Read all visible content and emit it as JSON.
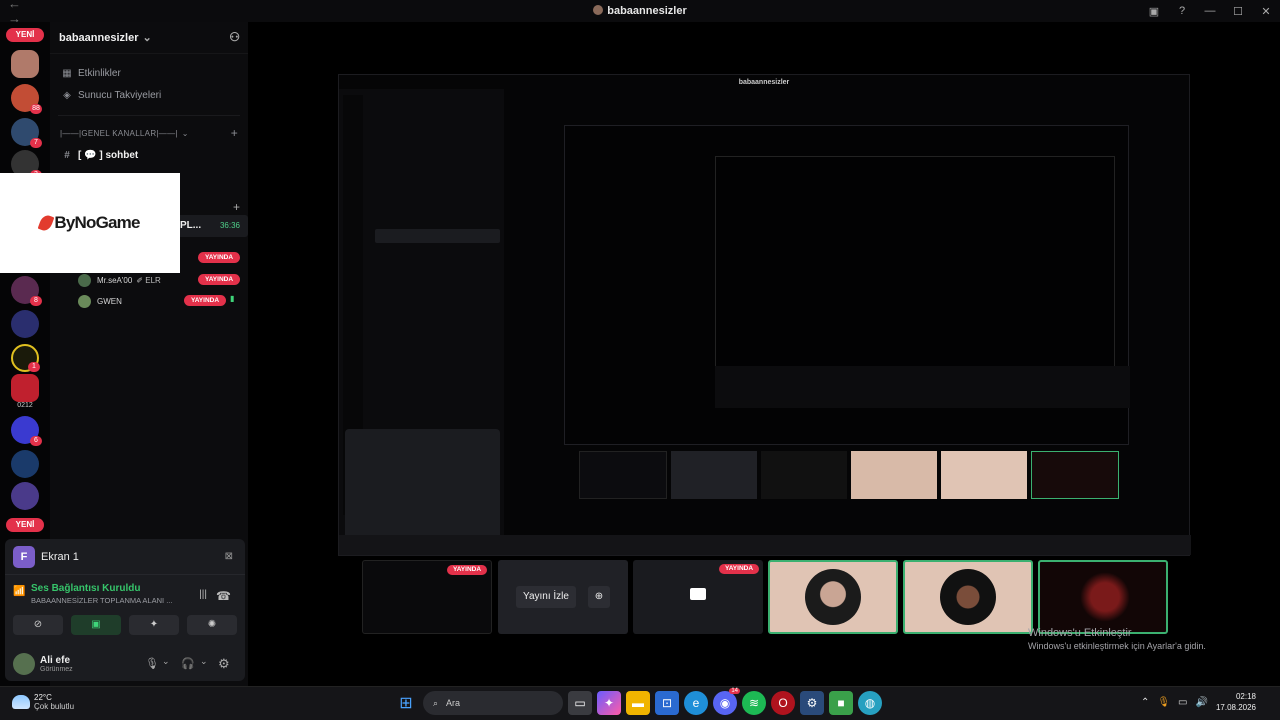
{
  "window": {
    "title": "babaannesizler"
  },
  "server_rail": {
    "new_badge_top": "YENİ",
    "new_badge_bottom": "YENİ",
    "server_counts": [
      "88",
      "7",
      "3",
      "8",
      "1",
      "8",
      "6"
    ],
    "server_label_0212": "0212"
  },
  "guild": {
    "name": "babaannesizler",
    "events_label": "Etkinlikler",
    "boosts_label": "Sunucu Takviyeleri",
    "category_general": "|——|GENEL KANALLAR|——|",
    "channel_chat": "[ 💬 ] sohbet",
    "voice_channel_short": "PL...",
    "voice_time": "36:36"
  },
  "voice_users": [
    {
      "name": "Mr.seA'00",
      "tag": "ELR",
      "status": "YAYINDA"
    },
    {
      "name": "GWEN",
      "status": "YAYINDA"
    }
  ],
  "voice_live_first": "YAYINDA",
  "ad": {
    "brand": "ByNoGame"
  },
  "panel": {
    "stream_title": "Ekran 1",
    "stream_icon_letter": "F",
    "connection_status": "Ses Bağlantısı Kuruldu",
    "connection_channel": "BABAANNESİZLER TOPLANMA ALANI ...",
    "user_name": "Ali efe",
    "user_status": "Görünmez"
  },
  "stream_tiles": {
    "live_label": "YAYINDA",
    "watch_label": "Yayını İzle"
  },
  "activation": {
    "title": "Windows'u Etkinleştir",
    "subtitle": "Windows'u etkinleştirmek için Ayarlar'a gidin."
  },
  "inner_window": {
    "title": "babaannesizler"
  },
  "taskbar": {
    "temperature": "22°C",
    "weather": "Çok bulutlu",
    "search_placeholder": "Ara",
    "time": "02:18",
    "date": "17.08.2026",
    "discord_badge": "14"
  }
}
